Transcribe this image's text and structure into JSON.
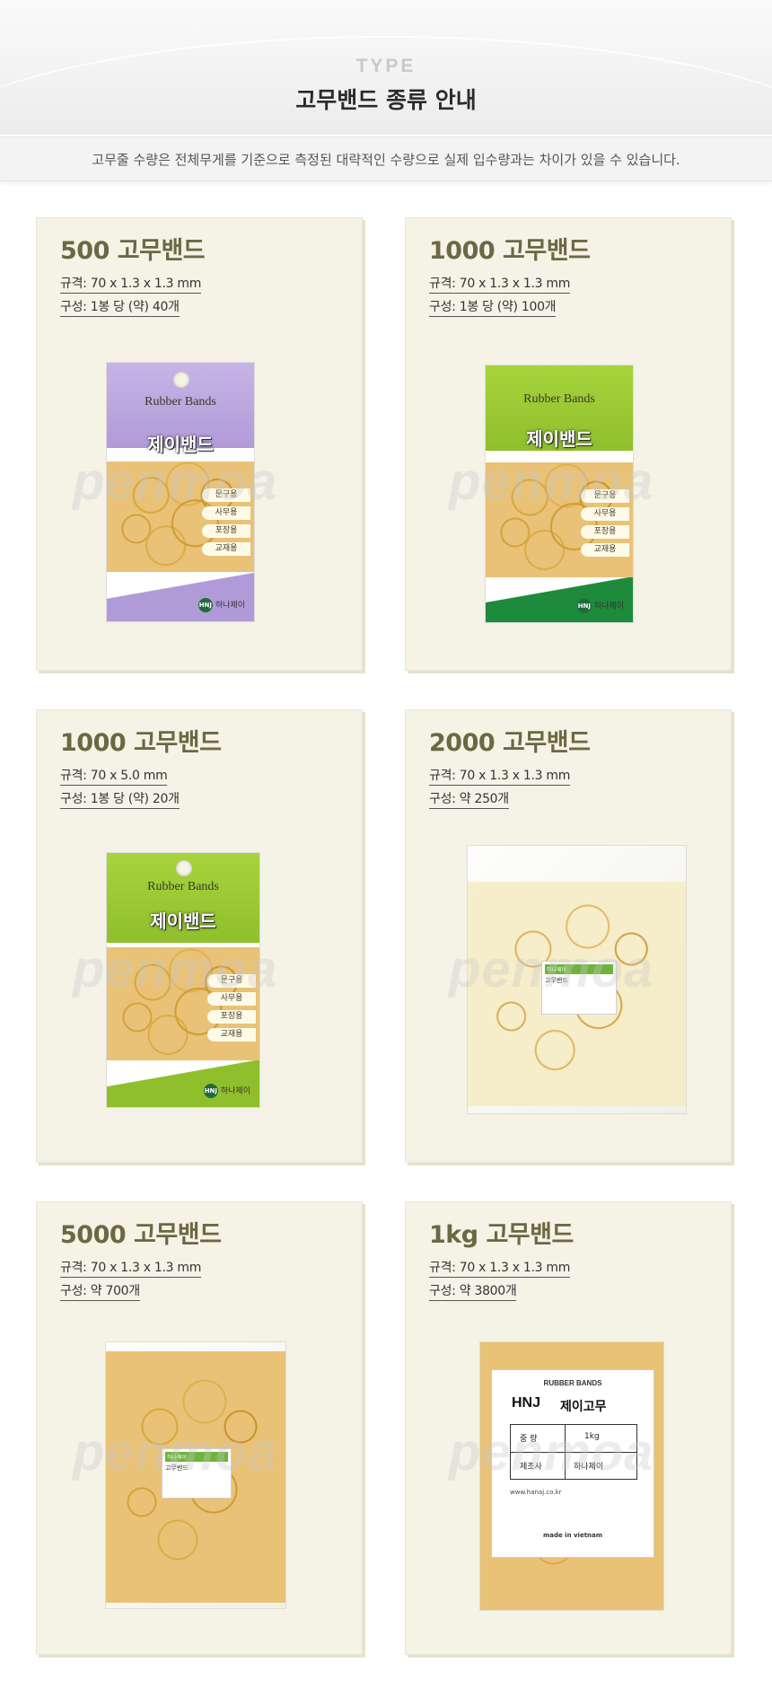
{
  "header": {
    "type_label": "TYPE",
    "title": "고무밴드 종류 안내",
    "notice": "고무줄 수량은 전체무게를 기준으로 측정된 대략적인 수량으로 실제 입수량과는 차이가 있을 수 있습니다."
  },
  "colors": {
    "card_bg": "#f5f2e6",
    "card_title": "#6b6843",
    "purple_pkg": "#b8a4dc",
    "green_pkg": "#9cc936",
    "rubber": "#d9a53a"
  },
  "products": [
    {
      "name": "500 고무밴드",
      "spec": "규격: 70 x 1.3 x 1.3 mm",
      "composition": "구성: 1봉 당 (약) 40개",
      "image_icon": "purple-rubber-band-package"
    },
    {
      "name": "1000 고무밴드",
      "spec": "규격: 70 x 1.3 x 1.3 mm",
      "composition": "구성: 1봉 당 (약) 100개",
      "image_icon": "green-rubber-band-package"
    },
    {
      "name": "1000 고무밴드",
      "spec": "규격: 70 x 5.0 mm",
      "composition": "구성: 1봉 당 (약) 20개",
      "image_icon": "green-rubber-band-package"
    },
    {
      "name": "2000 고무밴드",
      "spec": "규격: 70 x 1.3 x 1.3 mm",
      "composition": "구성: 약 250개",
      "image_icon": "clear-rubber-band-bag"
    },
    {
      "name": "5000 고무밴드",
      "spec": "규격: 70 x 1.3 x 1.3 mm",
      "composition": "구성: 약 700개",
      "image_icon": "clear-rubber-band-bag"
    },
    {
      "name": "1kg 고무밴드",
      "spec": "규격: 70 x 1.3 x 1.3 mm",
      "composition": "구성: 약 3800개",
      "image_icon": "labeled-rubber-band-bag"
    }
  ],
  "package": {
    "brand_en": "Rubber Bands",
    "brand_ko": "제이밴드",
    "usages": [
      "문구용",
      "사무용",
      "포장용",
      "교재용"
    ],
    "maker": "하나제이",
    "maker_logo": "HNJ"
  },
  "bag_label": {
    "header": "하나제이",
    "product": "고무밴드"
  },
  "kg_bag": {
    "brand_en": "RUBBER BANDS",
    "logo": "HNJ",
    "name": "제이고무",
    "weight_label": "중 량",
    "weight_value": "1kg",
    "maker_label": "제조사",
    "maker_value": "하나제이",
    "website": "www.hanaj.co.kr",
    "origin": "made in vietnam"
  },
  "watermark": "penmoa"
}
